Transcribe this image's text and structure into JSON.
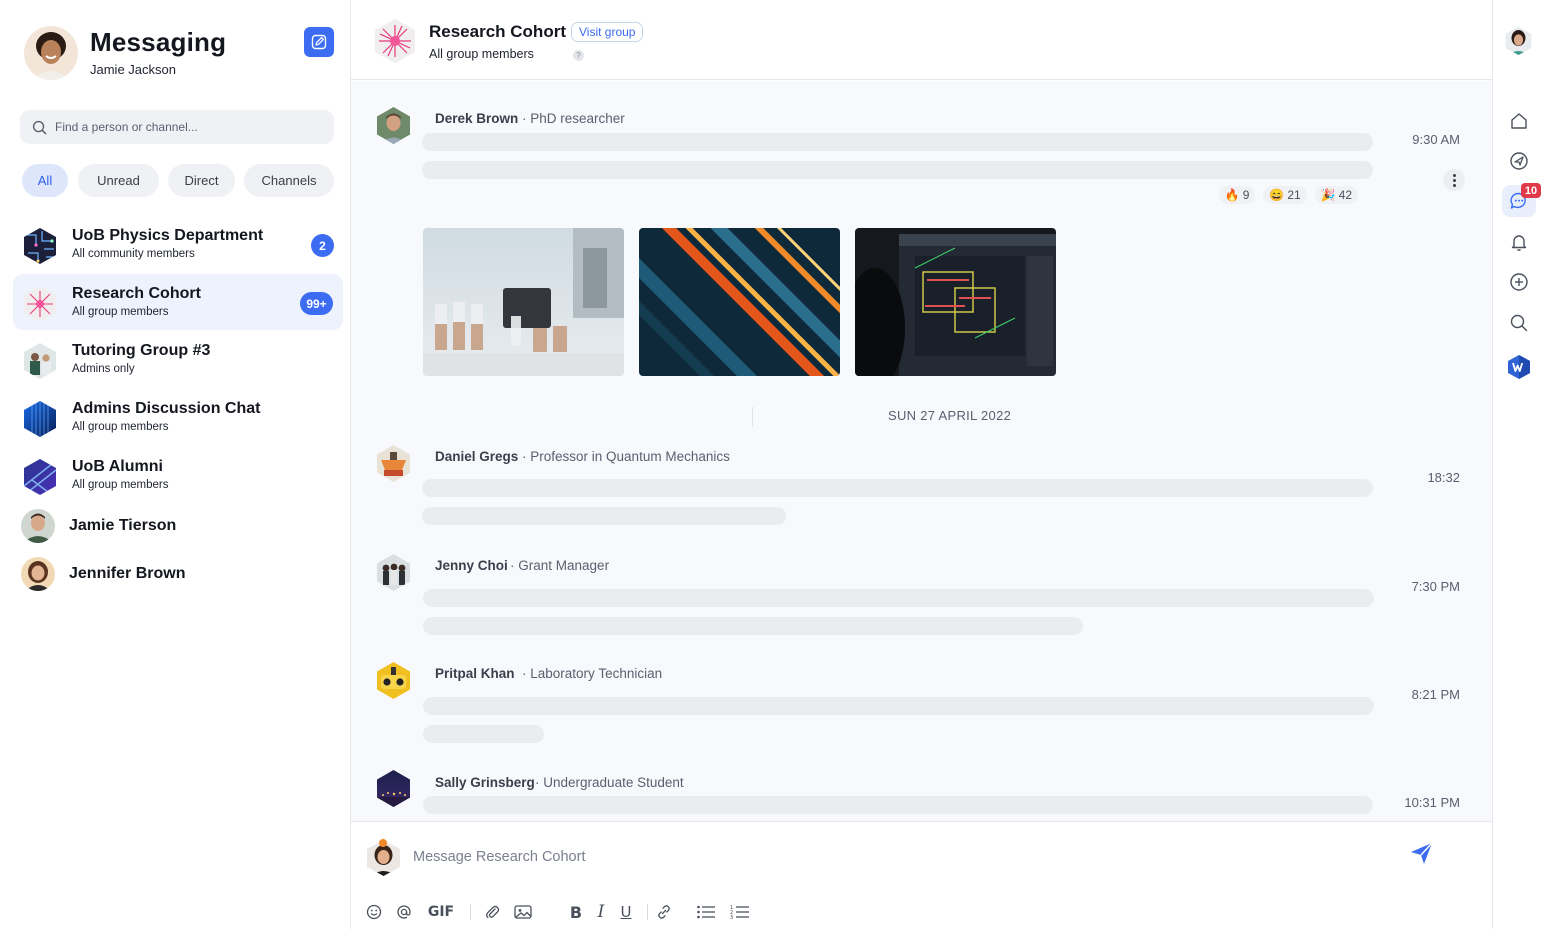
{
  "sidebar": {
    "title": "Messaging",
    "user_name": "Jamie Jackson",
    "search_placeholder": "Find a person or channel...",
    "filters": [
      {
        "label": "All",
        "active": true
      },
      {
        "label": "Unread",
        "active": false
      },
      {
        "label": "Direct",
        "active": false
      },
      {
        "label": "Channels",
        "active": false
      }
    ],
    "conversations": [
      {
        "name": "UoB Physics Department",
        "subtitle": "All community members",
        "badge": "2",
        "icon": "circuit-board-hex-icon"
      },
      {
        "name": "Research Cohort",
        "subtitle": "All group members",
        "badge": "99+",
        "active": true,
        "icon": "pink-burst-hex-icon"
      },
      {
        "name": "Tutoring Group #3",
        "subtitle": "Admins only",
        "icon": "students-hex-icon"
      },
      {
        "name": "Admins Discussion Chat",
        "subtitle": "All group members",
        "icon": "blue-building-hex-icon"
      },
      {
        "name": "UoB Alumni",
        "subtitle": "All group members",
        "icon": "blue-abstract-hex-icon"
      },
      {
        "name": "Jamie Tierson",
        "icon": "man-avatar-icon"
      },
      {
        "name": "Jennifer Brown",
        "icon": "woman-avatar-icon"
      }
    ]
  },
  "header": {
    "title": "Research Cohort",
    "visit_label": "Visit group",
    "subtitle": "All group members",
    "help": "?"
  },
  "messages": [
    {
      "author": "Derek Brown",
      "role": "PhD researcher",
      "time": "9:30 AM",
      "reactions": [
        {
          "emoji": "🔥",
          "count": "9"
        },
        {
          "emoji": "😄",
          "count": "21"
        },
        {
          "emoji": "🎉",
          "count": "42"
        }
      ],
      "images": [
        "lab-vials-image",
        "light-streaks-image",
        "cad-screen-image"
      ]
    },
    {
      "author": "Daniel Gregs",
      "role": "Professor in Quantum Mechanics",
      "time": "18:32"
    },
    {
      "author": "Jenny Choi",
      "role": "Grant Manager",
      "time": "7:30 PM"
    },
    {
      "author": "Pritpal Khan",
      "role": "Laboratory Technician",
      "time": "8:21 PM"
    },
    {
      "author": "Sally Grinsberg",
      "role": "Undergraduate Student",
      "time": "10:31 PM"
    }
  ],
  "date_separator": "SUN 27 APRIL 2022",
  "separator_dot": "·",
  "composer": {
    "placeholder": "Message Research Cohort",
    "tools": [
      "emoji-icon",
      "mention-icon",
      "gif-icon",
      "attach-icon",
      "image-icon",
      "bold-icon",
      "italic-icon",
      "underline-icon",
      "link-icon",
      "bullet-list-icon",
      "numbered-list-icon"
    ],
    "gif_label": "GIF",
    "bold_label": "B",
    "italic_label": "I",
    "underline_label": "U"
  },
  "rail": {
    "items": [
      "home-icon",
      "send-icon",
      "chat-icon",
      "bell-icon",
      "plus-circle-icon",
      "search-icon",
      "workspace-logo-icon"
    ],
    "chat_badge": "10"
  },
  "colors": {
    "accent": "#3b6cf2",
    "badge_red": "#e03a4a",
    "active_bg": "#eef2fd",
    "skeleton": "#ebecef"
  }
}
